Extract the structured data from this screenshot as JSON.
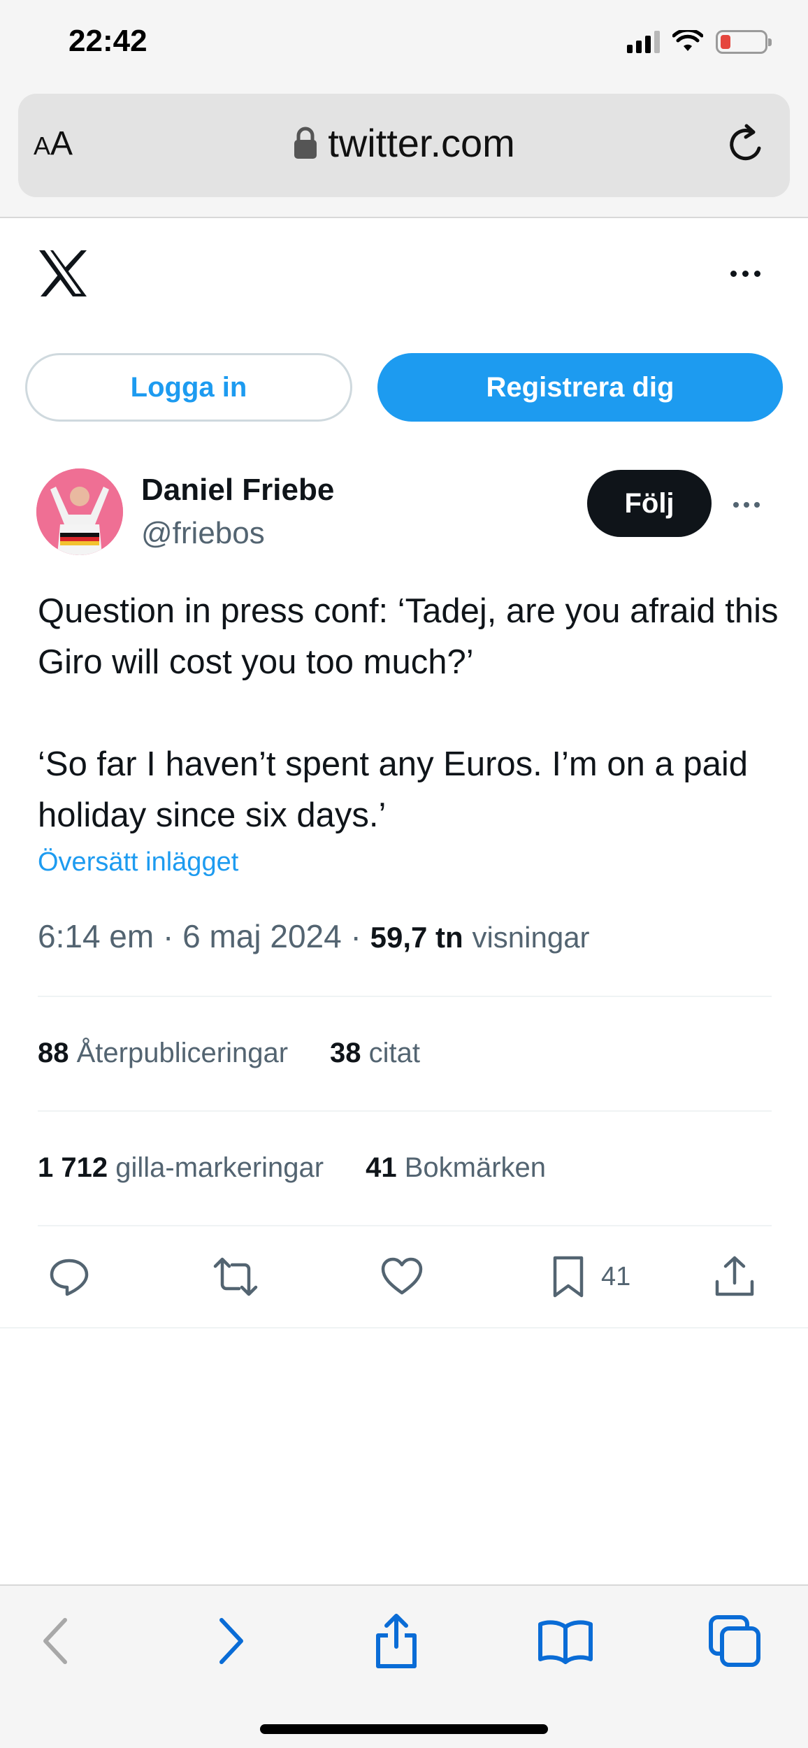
{
  "status_bar": {
    "time": "22:42",
    "battery_level": 0.15,
    "battery_color": "#e5463e"
  },
  "browser": {
    "text_size_button": "AA",
    "url": "twitter.com",
    "icons": [
      "lock-icon",
      "reload-icon"
    ]
  },
  "header": {
    "logo": "x-logo",
    "more_icon": "more-icon",
    "login_label": "Logga in",
    "signup_label": "Registrera dig"
  },
  "tweet": {
    "author_name": "Daniel Friebe",
    "author_handle": "@friebos",
    "follow_label": "Följ",
    "text_para1": "Question in press conf: ‘Tadej, are you afraid this Giro will cost you too much?’",
    "text_para2": "‘So far I haven’t spent any Euros. I’m on a paid holiday since six days.’",
    "translate_label": "Översätt inlägget",
    "time": "6:14 em",
    "date": "6 maj 2024",
    "views_count": "59,7 tn",
    "views_label": "visningar",
    "reposts_count": "88",
    "reposts_label": "Återpubliceringar",
    "quotes_count": "38",
    "quotes_label": "citat",
    "likes_count": "1 712",
    "likes_label": "gilla-markeringar",
    "bookmarks_count": "41",
    "bookmarks_label": "Bokmärken",
    "bookmark_action_count": "41"
  },
  "colors": {
    "accent": "#1d9bf0",
    "text_primary": "#0f1419",
    "text_secondary": "#536471",
    "safari_blue": "#0a6cd6"
  }
}
